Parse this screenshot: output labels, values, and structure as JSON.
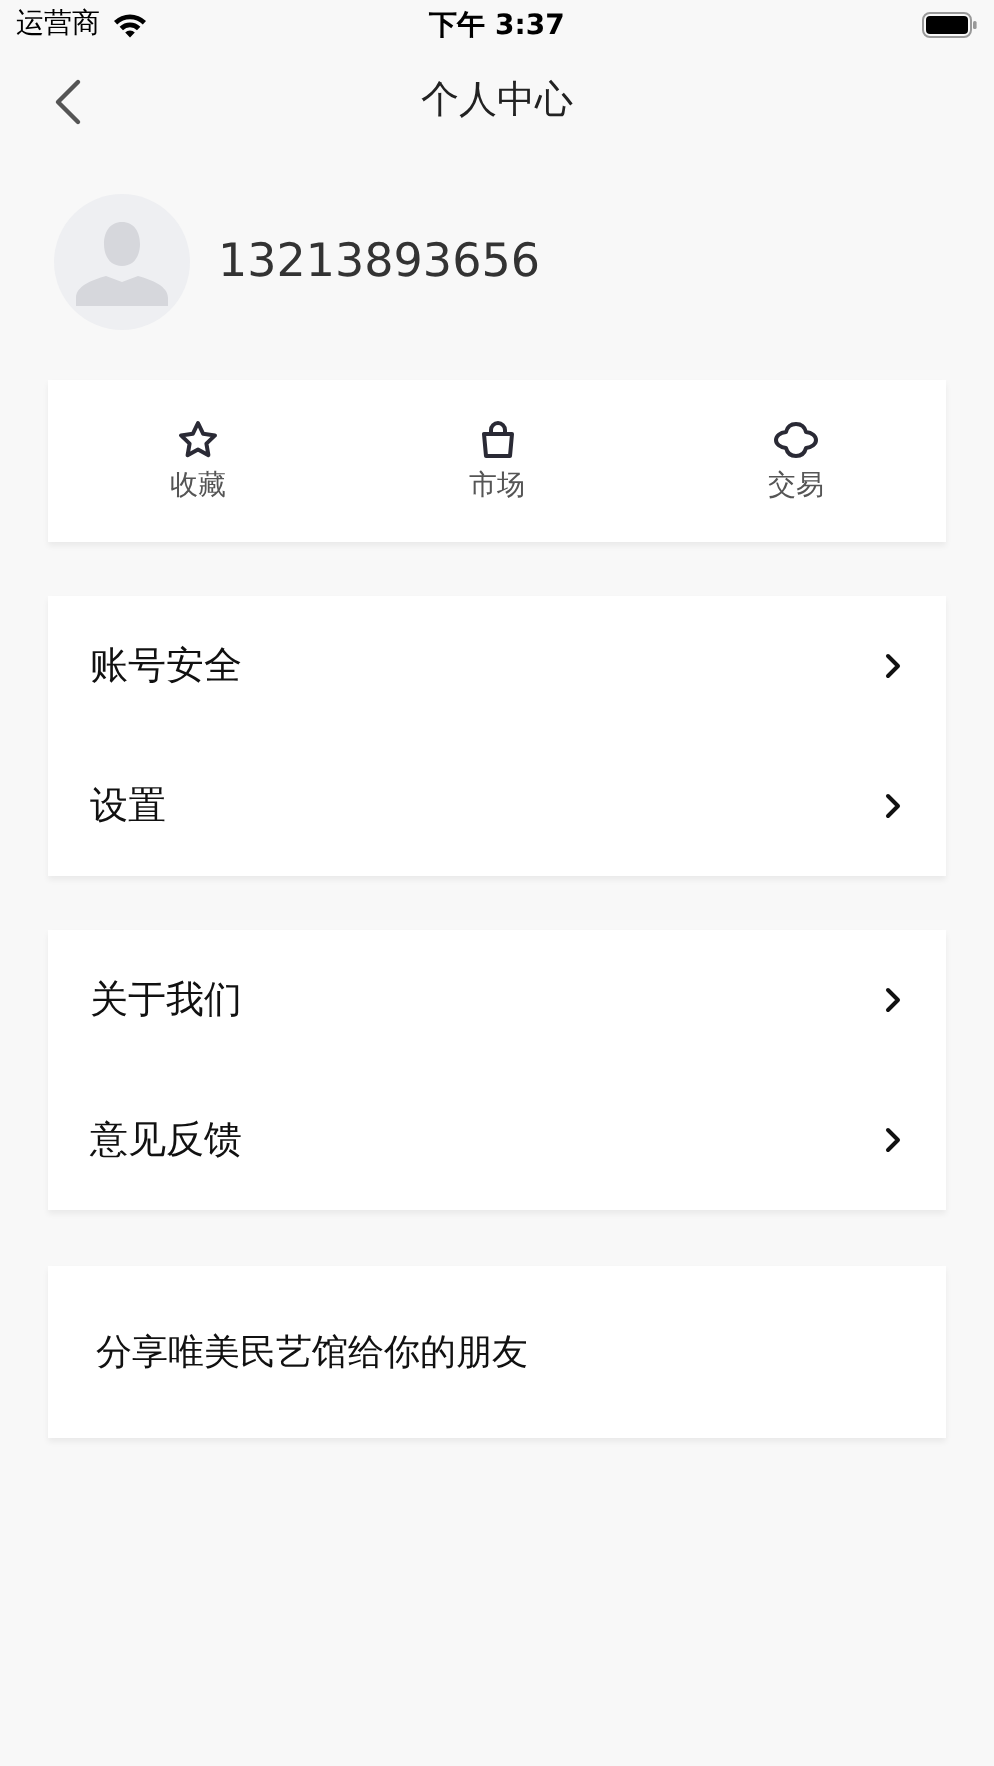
{
  "status_bar": {
    "carrier": "运营商",
    "time": "下午 3:37"
  },
  "nav": {
    "title": "个人中心"
  },
  "profile": {
    "name": "13213893656"
  },
  "shortcuts": [
    {
      "label": "收藏"
    },
    {
      "label": "市场"
    },
    {
      "label": "交易"
    }
  ],
  "menu_groups": [
    [
      {
        "label": "账号安全"
      },
      {
        "label": "设置"
      }
    ],
    [
      {
        "label": "关于我们"
      },
      {
        "label": "意见反馈"
      }
    ]
  ],
  "share": {
    "label": "分享唯美民艺馆给你的朋友"
  }
}
